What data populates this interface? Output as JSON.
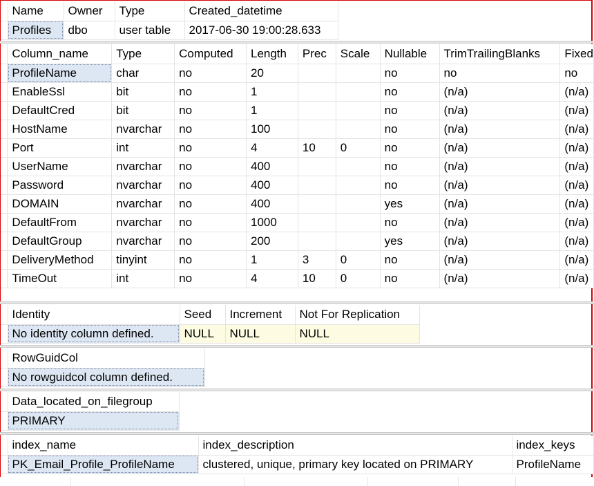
{
  "grid1": {
    "headers": [
      "Name",
      "Owner",
      "Type",
      "Created_datetime"
    ],
    "row": [
      "Profiles",
      "dbo",
      "user table",
      "2017-06-30 19:00:28.633"
    ]
  },
  "grid2": {
    "headers": [
      "Column_name",
      "Type",
      "Computed",
      "Length",
      "Prec",
      "Scale",
      "Nullable",
      "TrimTrailingBlanks",
      "Fixed"
    ],
    "rows": [
      [
        "ProfileName",
        "char",
        "no",
        "20",
        "",
        "",
        "no",
        "no",
        "no"
      ],
      [
        "EnableSsl",
        "bit",
        "no",
        "1",
        "",
        "",
        "no",
        "(n/a)",
        "(n/a)"
      ],
      [
        "DefaultCred",
        "bit",
        "no",
        "1",
        "",
        "",
        "no",
        "(n/a)",
        "(n/a)"
      ],
      [
        "HostName",
        "nvarchar",
        "no",
        "100",
        "",
        "",
        "no",
        "(n/a)",
        "(n/a)"
      ],
      [
        "Port",
        "int",
        "no",
        "4",
        "10",
        "0",
        "no",
        "(n/a)",
        "(n/a)"
      ],
      [
        "UserName",
        "nvarchar",
        "no",
        "400",
        "",
        "",
        "no",
        "(n/a)",
        "(n/a)"
      ],
      [
        "Password",
        "nvarchar",
        "no",
        "400",
        "",
        "",
        "no",
        "(n/a)",
        "(n/a)"
      ],
      [
        "DOMAIN",
        "nvarchar",
        "no",
        "400",
        "",
        "",
        "yes",
        "(n/a)",
        "(n/a)"
      ],
      [
        "DefaultFrom",
        "nvarchar",
        "no",
        "1000",
        "",
        "",
        "no",
        "(n/a)",
        "(n/a)"
      ],
      [
        "DefaultGroup",
        "nvarchar",
        "no",
        "200",
        "",
        "",
        "yes",
        "(n/a)",
        "(n/a)"
      ],
      [
        "DeliveryMethod",
        "tinyint",
        "no",
        "1",
        "3",
        "0",
        "no",
        "(n/a)",
        "(n/a)"
      ],
      [
        "TimeOut",
        "int",
        "no",
        "4",
        "10",
        "0",
        "no",
        "(n/a)",
        "(n/a)"
      ]
    ]
  },
  "grid3": {
    "headers": [
      "Identity",
      "Seed",
      "Increment",
      "Not For Replication"
    ],
    "row": [
      "No identity column defined.",
      "NULL",
      "NULL",
      "NULL"
    ]
  },
  "grid4": {
    "headers": [
      "RowGuidCol"
    ],
    "row": [
      "No rowguidcol column defined."
    ]
  },
  "grid5": {
    "headers": [
      "Data_located_on_filegroup"
    ],
    "row": [
      "PRIMARY"
    ]
  },
  "grid6": {
    "headers": [
      "index_name",
      "index_description",
      "index_keys"
    ],
    "row": [
      "PK_Email_Profile_ProfileName",
      "clustered, unique, primary key located on PRIMARY",
      "ProfileName"
    ]
  },
  "colors": {
    "selection": "#dde7f3",
    "null_cell": "#fdfbe1",
    "frame": "#d80000",
    "gridline": "#e4e4e4"
  }
}
